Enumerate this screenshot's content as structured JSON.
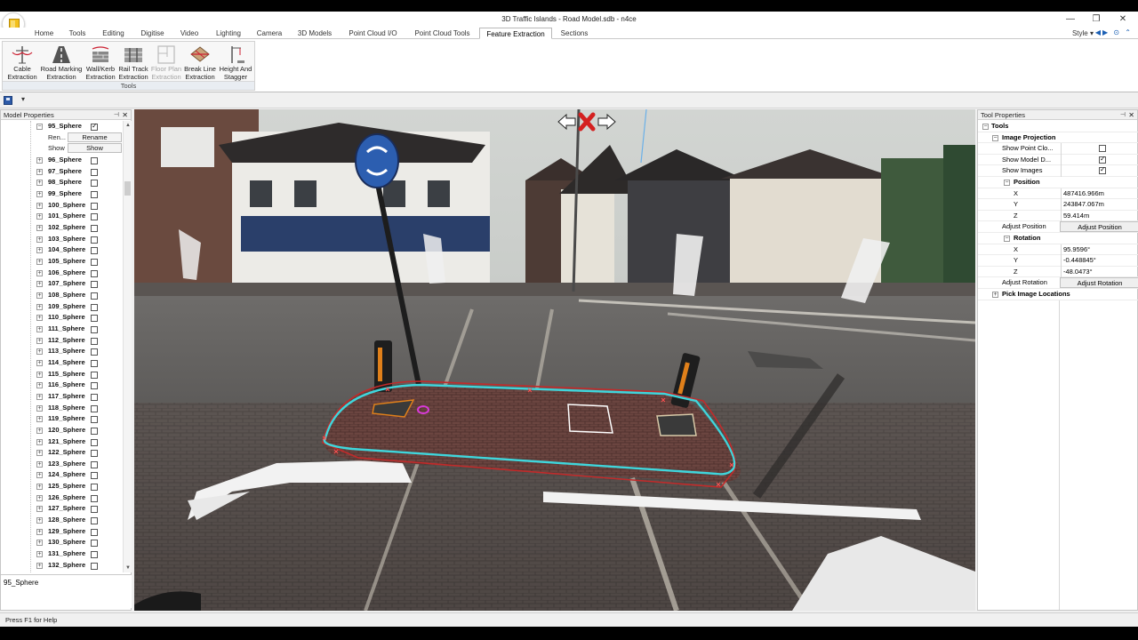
{
  "window": {
    "title": "3D Traffic Islands - Road Model.sdb - n4ce",
    "min": "—",
    "max": "❐",
    "close": "✕"
  },
  "tabs": [
    {
      "label": "Home",
      "active": false
    },
    {
      "label": "Tools",
      "active": false
    },
    {
      "label": "Editing",
      "active": false
    },
    {
      "label": "Digitise",
      "active": false
    },
    {
      "label": "Video",
      "active": false
    },
    {
      "label": "Lighting",
      "active": false
    },
    {
      "label": "Camera",
      "active": false
    },
    {
      "label": "3D Models",
      "active": false
    },
    {
      "label": "Point Cloud I/O",
      "active": false
    },
    {
      "label": "Point Cloud Tools",
      "active": false
    },
    {
      "label": "Feature Extraction",
      "active": true
    },
    {
      "label": "Sections",
      "active": false
    }
  ],
  "style_menu": "Style",
  "ribbon": {
    "group_label": "Tools",
    "buttons": [
      {
        "l1": "Cable",
        "l2": "Extraction",
        "icon": "cable-extraction-icon",
        "enabled": true
      },
      {
        "l1": "Road Marking",
        "l2": "Extraction",
        "icon": "road-marking-icon",
        "enabled": true
      },
      {
        "l1": "Wall/Kerb",
        "l2": "Extraction",
        "icon": "wall-kerb-icon",
        "enabled": true
      },
      {
        "l1": "Rail Track",
        "l2": "Extraction",
        "icon": "rail-track-icon",
        "enabled": true
      },
      {
        "l1": "Floor Plan",
        "l2": "Extraction",
        "icon": "floor-plan-icon",
        "enabled": false
      },
      {
        "l1": "Break Line",
        "l2": "Extraction",
        "icon": "break-line-icon",
        "enabled": true
      },
      {
        "l1": "Height And",
        "l2": "Stagger",
        "icon": "height-stagger-icon",
        "enabled": true
      }
    ]
  },
  "model_properties": {
    "title": "Model Properties",
    "expanded_item": {
      "label": "95_Sphere",
      "checked": true,
      "sub_rows": [
        {
          "key": "Ren...",
          "button": "Rename"
        },
        {
          "key": "Show",
          "button": "Show"
        }
      ]
    },
    "items": [
      "96_Sphere",
      "97_Sphere",
      "98_Sphere",
      "99_Sphere",
      "100_Sphere",
      "101_Sphere",
      "102_Sphere",
      "103_Sphere",
      "104_Sphere",
      "105_Sphere",
      "106_Sphere",
      "107_Sphere",
      "108_Sphere",
      "109_Sphere",
      "110_Sphere",
      "111_Sphere",
      "112_Sphere",
      "113_Sphere",
      "114_Sphere",
      "115_Sphere",
      "116_Sphere",
      "117_Sphere",
      "118_Sphere",
      "119_Sphere",
      "120_Sphere",
      "121_Sphere",
      "122_Sphere",
      "123_Sphere",
      "124_Sphere",
      "125_Sphere",
      "126_Sphere",
      "127_Sphere",
      "128_Sphere",
      "129_Sphere",
      "130_Sphere",
      "131_Sphere",
      "132_Sphere"
    ],
    "description": "95_Sphere"
  },
  "tool_properties": {
    "title": "Tool Properties",
    "tools_label": "Tools",
    "image_projection_label": "Image Projection",
    "show_point_cloud": {
      "label": "Show Point Clo...",
      "checked": false
    },
    "show_model_data": {
      "label": "Show Model D...",
      "checked": true
    },
    "show_images": {
      "label": "Show Images",
      "checked": true
    },
    "position_label": "Position",
    "position": {
      "x_label": "X",
      "x": "487416.966m",
      "y_label": "Y",
      "y": "243847.067m",
      "z_label": "Z",
      "z": "59.414m"
    },
    "adjust_position": {
      "label": "Adjust Position",
      "button": "Adjust Position"
    },
    "rotation_label": "Rotation",
    "rotation": {
      "x_label": "X",
      "x": "95.9596°",
      "y_label": "Y",
      "y": "-0.448845°",
      "z_label": "Z",
      "z": "-48.0473°"
    },
    "adjust_rotation": {
      "label": "Adjust Rotation",
      "button": "Adjust Rotation"
    },
    "pick_image_locations": "Pick Image Locations"
  },
  "status": "Press F1 for Help",
  "colors": {
    "outline": "#3fd6dc",
    "accent_red": "#d42020",
    "active_tab_border": "#b7b7b7"
  }
}
